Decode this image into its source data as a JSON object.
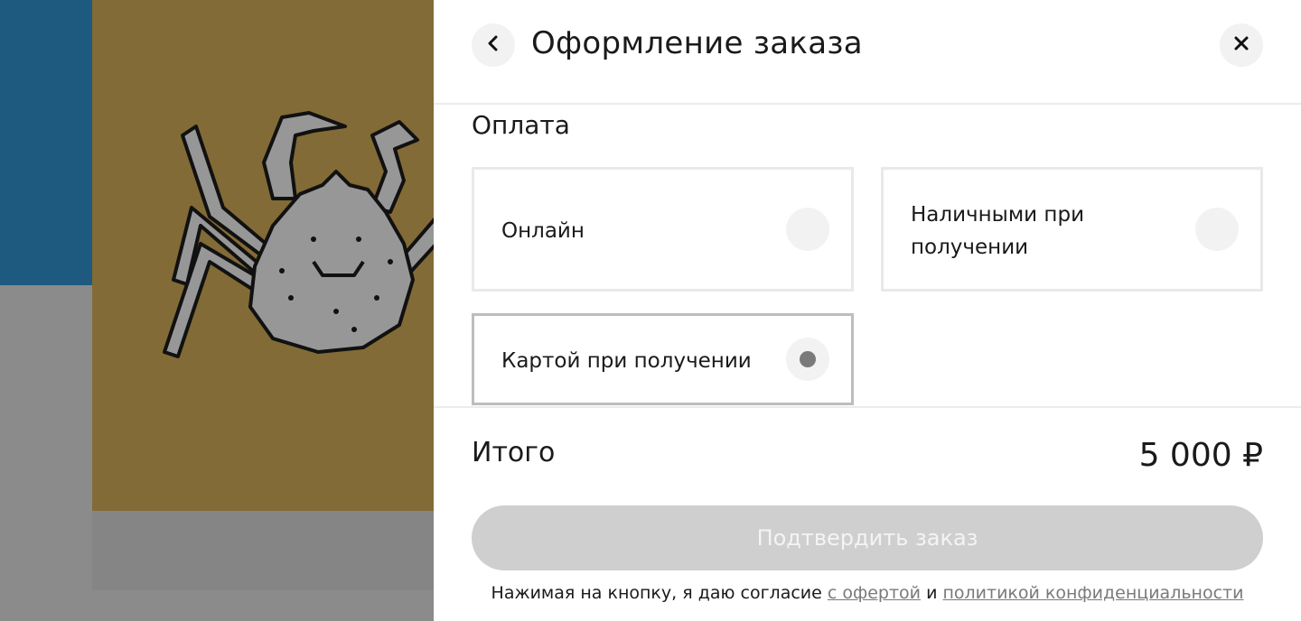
{
  "header": {
    "title": "Оформление заказа",
    "back_icon": "chevron-left-icon",
    "close_icon": "close-icon"
  },
  "payment": {
    "section_title": "Оплата",
    "options": [
      {
        "label": "Онлайн",
        "selected": false
      },
      {
        "label": "Наличными при получении",
        "selected": false
      },
      {
        "label": "Картой при получении",
        "selected": true
      }
    ]
  },
  "total": {
    "label": "Итого",
    "value": "5 000 ₽"
  },
  "confirm": {
    "label": "Подтвердить заказ"
  },
  "consent": {
    "prefix": "Нажимая на кнопку, я даю согласие ",
    "offer_link": "с офертой",
    "middle": " и ",
    "privacy_link": "политикой конфиденциальности"
  },
  "colors": {
    "accent_blue": "#1e5a80",
    "image_bg": "#826b36",
    "button_disabled": "#cfcfcf"
  }
}
